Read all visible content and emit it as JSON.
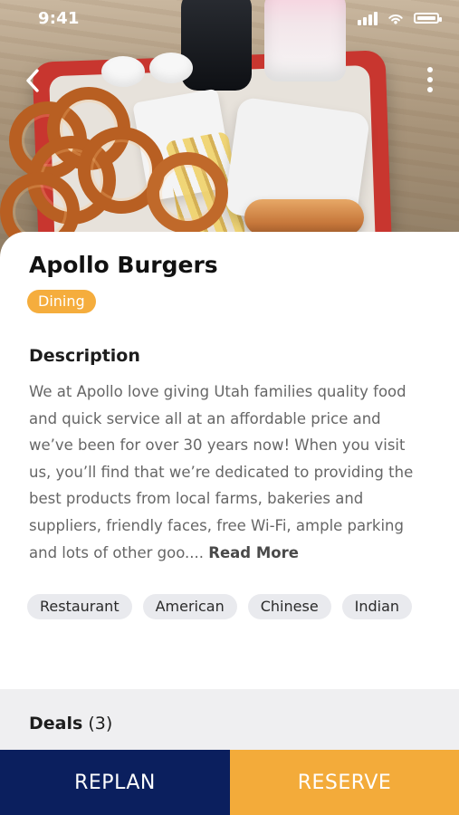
{
  "status_bar": {
    "time": "9:41"
  },
  "header": {
    "back_icon": "chevron-left-icon",
    "more_icon": "more-vertical-icon"
  },
  "place": {
    "name": "Apollo Burgers",
    "category": "Dining",
    "description_heading": "Description",
    "description_text": "We at Apollo love giving Utah families quality food and quick service all at an affordable price and we’ve been for over 30 years now! When you visit us, you’ll find that we’re dedicated to providing the best products from local farms, bakeries and suppliers, friendly faces, free Wi-Fi, ample parking and lots of other goo.... ",
    "read_more": "Read More",
    "tags": [
      "Restaurant",
      "American",
      "Chinese",
      "Indian"
    ]
  },
  "deals": {
    "label": "Deals",
    "count": "(3)"
  },
  "actions": {
    "replan": "REPLAN",
    "reserve": "RESERVE"
  },
  "colors": {
    "primary_navy": "#0b1f5e",
    "accent_orange": "#f3ab3a",
    "category_chip": "#f5ad3d"
  }
}
